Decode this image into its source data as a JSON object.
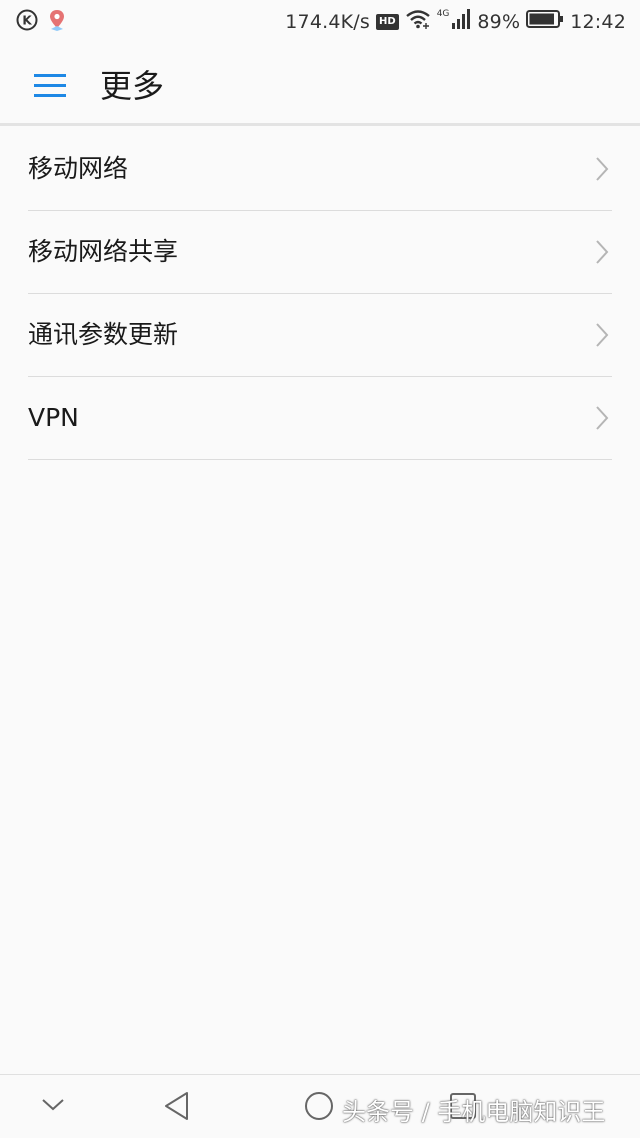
{
  "status_bar": {
    "left_icons": [
      "k-circle-icon",
      "maps-pin-icon"
    ],
    "network_speed": "174.4K/s",
    "hd_label": "HD",
    "network_type": "4G",
    "battery_percent": "89%",
    "battery_level": 0.89,
    "time": "12:42"
  },
  "app_bar": {
    "menu_icon": "hamburger-menu-icon",
    "title": "更多",
    "accent_color": "#1e88e5"
  },
  "list": {
    "items": [
      {
        "label": "移动网络"
      },
      {
        "label": "移动网络共享"
      },
      {
        "label": "通讯参数更新"
      },
      {
        "label": "VPN"
      }
    ],
    "chevron_icon": "chevron-right-icon"
  },
  "nav_bar": {
    "icons": [
      "chevron-down-icon",
      "back-triangle-icon",
      "home-circle-icon",
      "recents-square-icon"
    ]
  },
  "watermark": {
    "text": "头条号 / 手机电脑知识王"
  }
}
